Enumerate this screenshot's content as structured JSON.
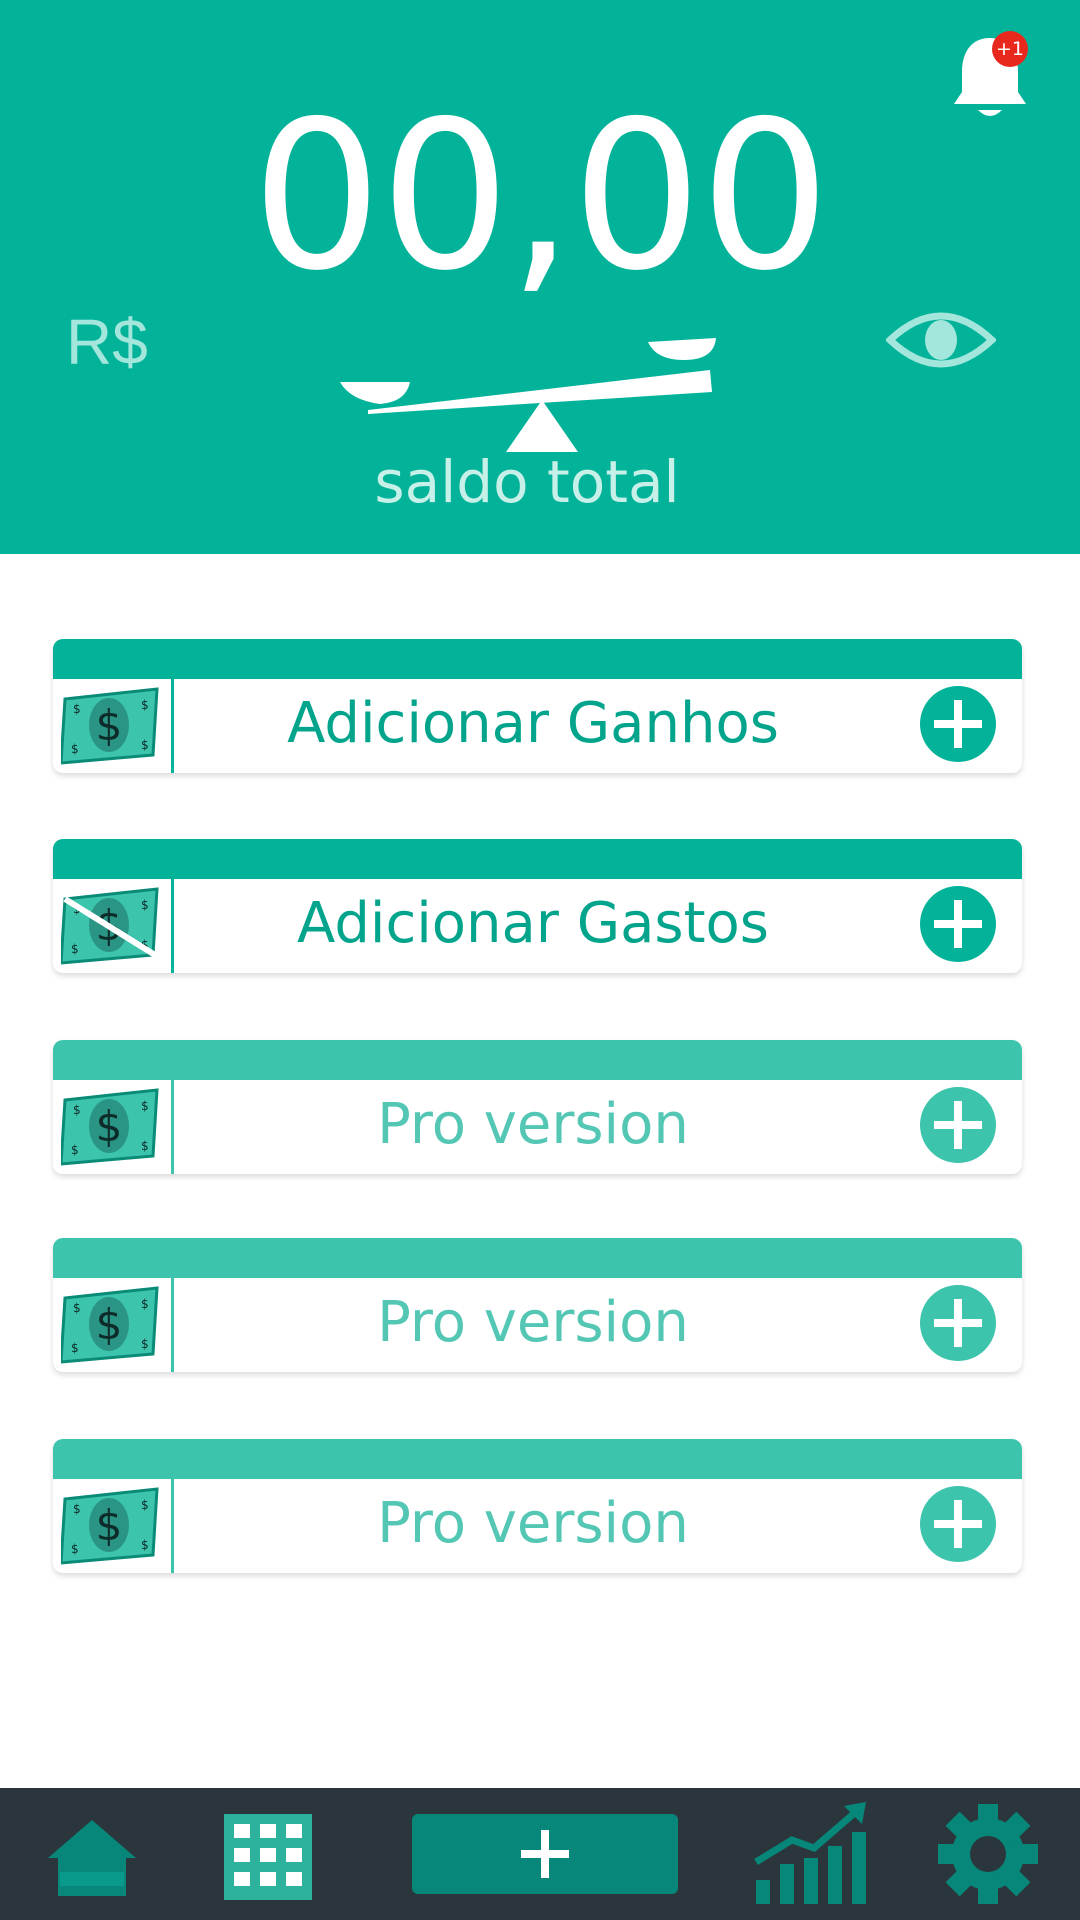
{
  "header": {
    "balance": "00,00",
    "currency": "R$",
    "total_label": "saldo total",
    "notification_badge": "+1",
    "icons": [
      "bell-icon",
      "eye-icon",
      "balance-scale-icon"
    ]
  },
  "cards": [
    {
      "label": "Adicionar Ganhos",
      "icon": "money-income-icon",
      "action_icon": "plus-circle-icon"
    },
    {
      "label": "Adicionar Gastos",
      "icon": "money-expense-icon",
      "action_icon": "plus-circle-icon"
    },
    {
      "label": "Pro version",
      "icon": "money-icon",
      "action_icon": "plus-circle-icon"
    },
    {
      "label": "Pro version",
      "icon": "money-icon",
      "action_icon": "plus-circle-icon"
    },
    {
      "label": "Pro version",
      "icon": "money-icon",
      "action_icon": "plus-circle-icon"
    }
  ],
  "nav": {
    "items": [
      "home-icon",
      "calendar-icon",
      "add-icon",
      "chart-icon",
      "gear-icon"
    ]
  },
  "colors": {
    "primary": "#03b399",
    "primary_light": "#3cc4ad",
    "navbar": "#2a363b",
    "nav_icon": "#07877a",
    "badge": "#e8271d"
  }
}
